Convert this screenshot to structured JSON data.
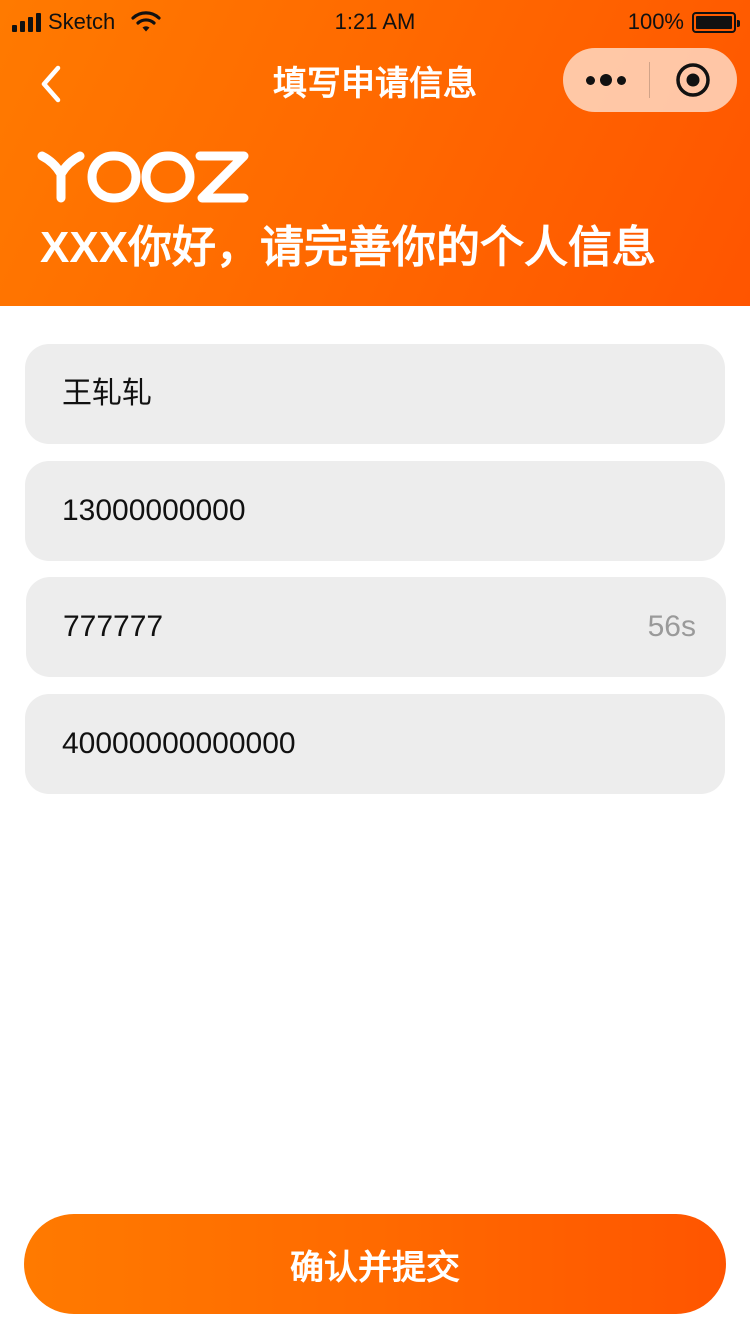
{
  "status_bar": {
    "carrier": "Sketch",
    "time": "1:21 AM",
    "battery": "100%"
  },
  "nav": {
    "title": "填写申请信息",
    "back_icon": "chevron-left-icon",
    "more_icon": "more-dots-icon",
    "close_icon": "target-circle-icon"
  },
  "header": {
    "logo": "YOOZ",
    "greeting": "XXX你好，请完善你的个人信息"
  },
  "form": {
    "name": "王轧轧",
    "phone": "13000000000",
    "code": "777777",
    "countdown": "56s",
    "id_number": "40000000000000"
  },
  "submit": {
    "label": "确认并提交"
  },
  "colors": {
    "accent_start": "#ff7a00",
    "accent_end": "#ff5500",
    "field_bg": "#ededed",
    "countdown_text": "#9a9a9a"
  }
}
